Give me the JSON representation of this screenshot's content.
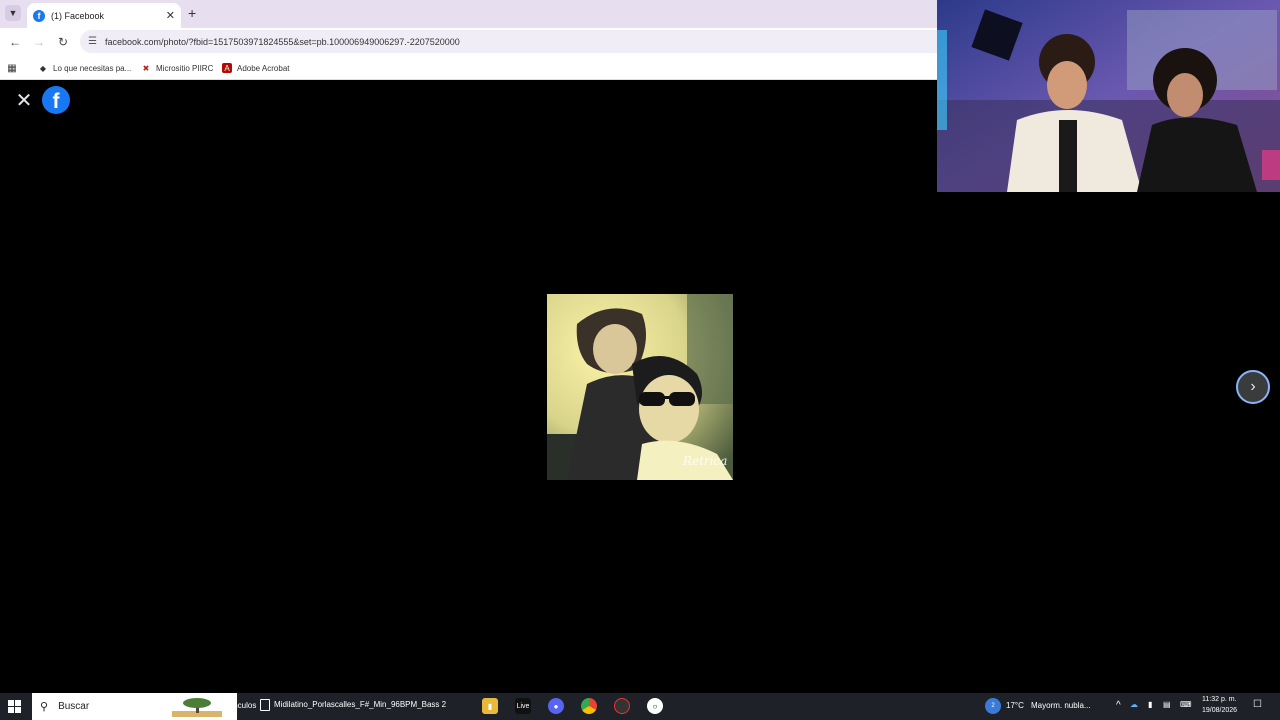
{
  "browser": {
    "tab": {
      "title": "(1) Facebook",
      "favicon": "f"
    },
    "url": "facebook.com/photo/?fbid=1517503971824555&set=pb.100006949006297.-2207520000",
    "bookmarks": [
      {
        "label": "Lo que necesitas pa..."
      },
      {
        "label": "Micrositio PIIRC"
      },
      {
        "label": "Adobe Acrobat"
      }
    ]
  },
  "viewer": {
    "logo": "f",
    "watermark": "Retrica"
  },
  "taskbar": {
    "search_label": "Buscar",
    "links_label": "ínculos",
    "window_title": "Midilatino_Porlascalles_F#_Min_96BPM_Bass 2",
    "live_label": "Live",
    "weather_temp": "17°C",
    "weather_desc": "Mayorm. nubla...",
    "weather_badge": "2",
    "time": "11:32 p. m.",
    "date": "19/08/2026"
  }
}
